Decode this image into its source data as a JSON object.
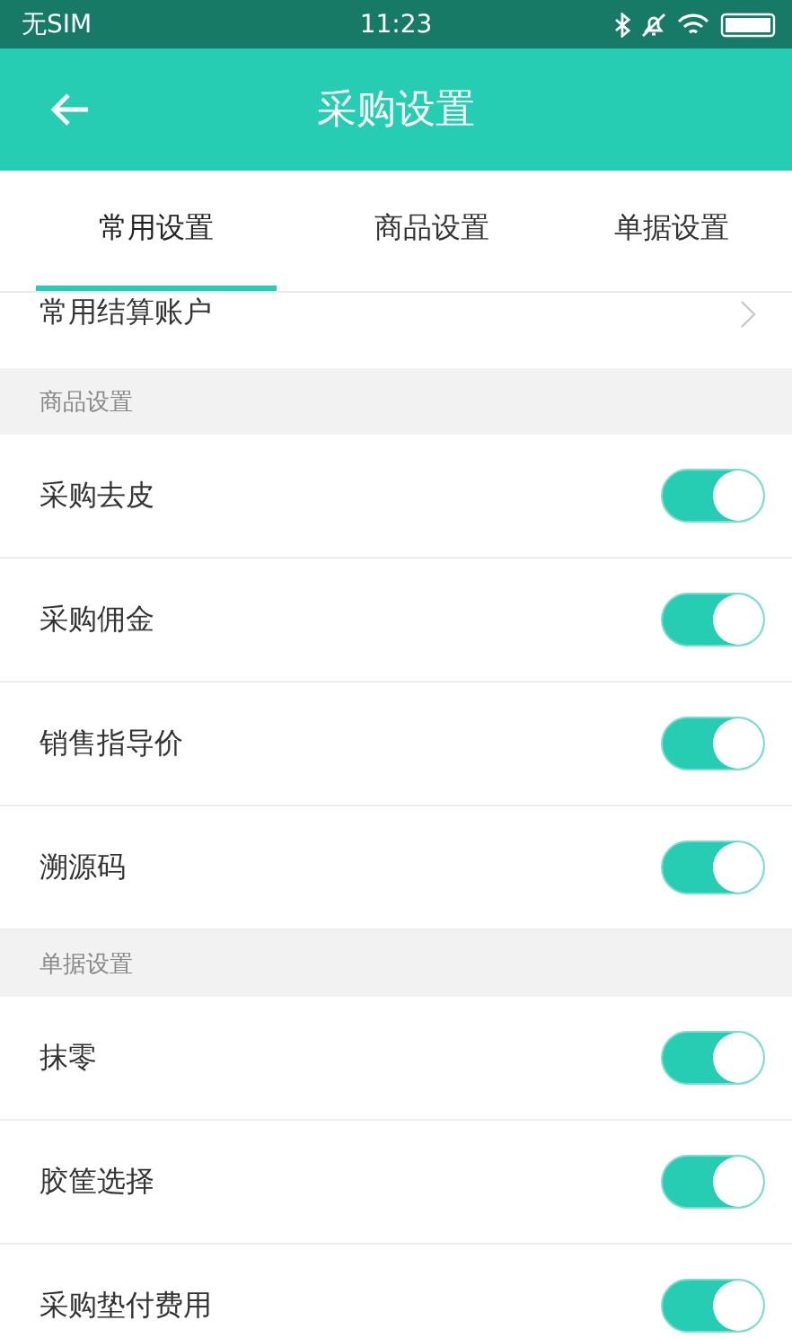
{
  "status_bar": {
    "carrier": "无SIM",
    "time": "11:23"
  },
  "header": {
    "title": "采购设置"
  },
  "tabs": [
    {
      "label": "常用设置",
      "selected": true
    },
    {
      "label": "商品设置",
      "selected": false
    },
    {
      "label": "单据设置",
      "selected": false
    }
  ],
  "sections": [
    {
      "items": [
        {
          "kind": "link",
          "label": "常用结算账户"
        }
      ]
    },
    {
      "title": "商品设置",
      "items": [
        {
          "kind": "toggle",
          "label": "采购去皮",
          "on": true
        },
        {
          "kind": "toggle",
          "label": "采购佣金",
          "on": true
        },
        {
          "kind": "toggle",
          "label": "销售指导价",
          "on": true
        },
        {
          "kind": "toggle",
          "label": "溯源码",
          "on": true
        }
      ]
    },
    {
      "title": "单据设置",
      "items": [
        {
          "kind": "toggle",
          "label": "抹零",
          "on": true
        },
        {
          "kind": "toggle",
          "label": "胶筐选择",
          "on": true
        },
        {
          "kind": "toggle",
          "label": "采购垫付费用",
          "on": true
        }
      ]
    }
  ]
}
